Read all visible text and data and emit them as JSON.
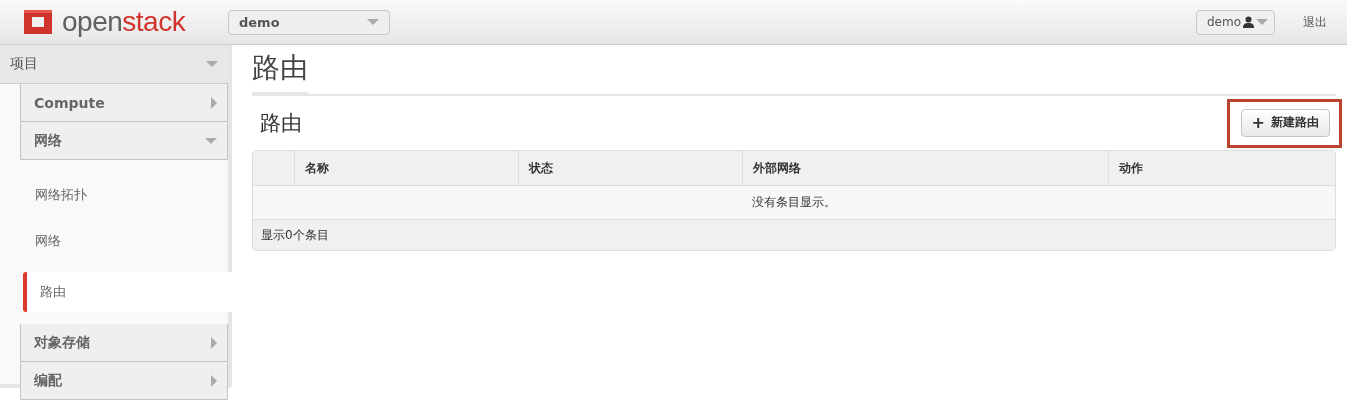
{
  "header": {
    "logo": {
      "light": "open",
      "strong": "stack"
    },
    "project_select": {
      "value": "demo"
    },
    "user_menu": {
      "label": "demo"
    },
    "logout": "退出"
  },
  "sidebar": [
    {
      "label": "项目",
      "expanded": true,
      "children": [
        {
          "label": "Compute",
          "expanded": false
        },
        {
          "label": "网络",
          "expanded": true,
          "children": [
            {
              "label": "网络拓扑",
              "selected": false
            },
            {
              "label": "网络",
              "selected": false
            },
            {
              "label": "路由",
              "selected": true
            }
          ]
        },
        {
          "label": "对象存储",
          "expanded": false
        },
        {
          "label": "编配",
          "expanded": false
        }
      ]
    }
  ],
  "page_title": "路由",
  "section": {
    "title": "路由",
    "create_button": {
      "icon": "+",
      "label": "新建路由",
      "highlighted": true
    }
  },
  "table": {
    "columns": [
      "名称",
      "状态",
      "外部网络",
      "动作"
    ],
    "empty_message": "没有条目显示。",
    "footer": "显示0个条目"
  }
}
